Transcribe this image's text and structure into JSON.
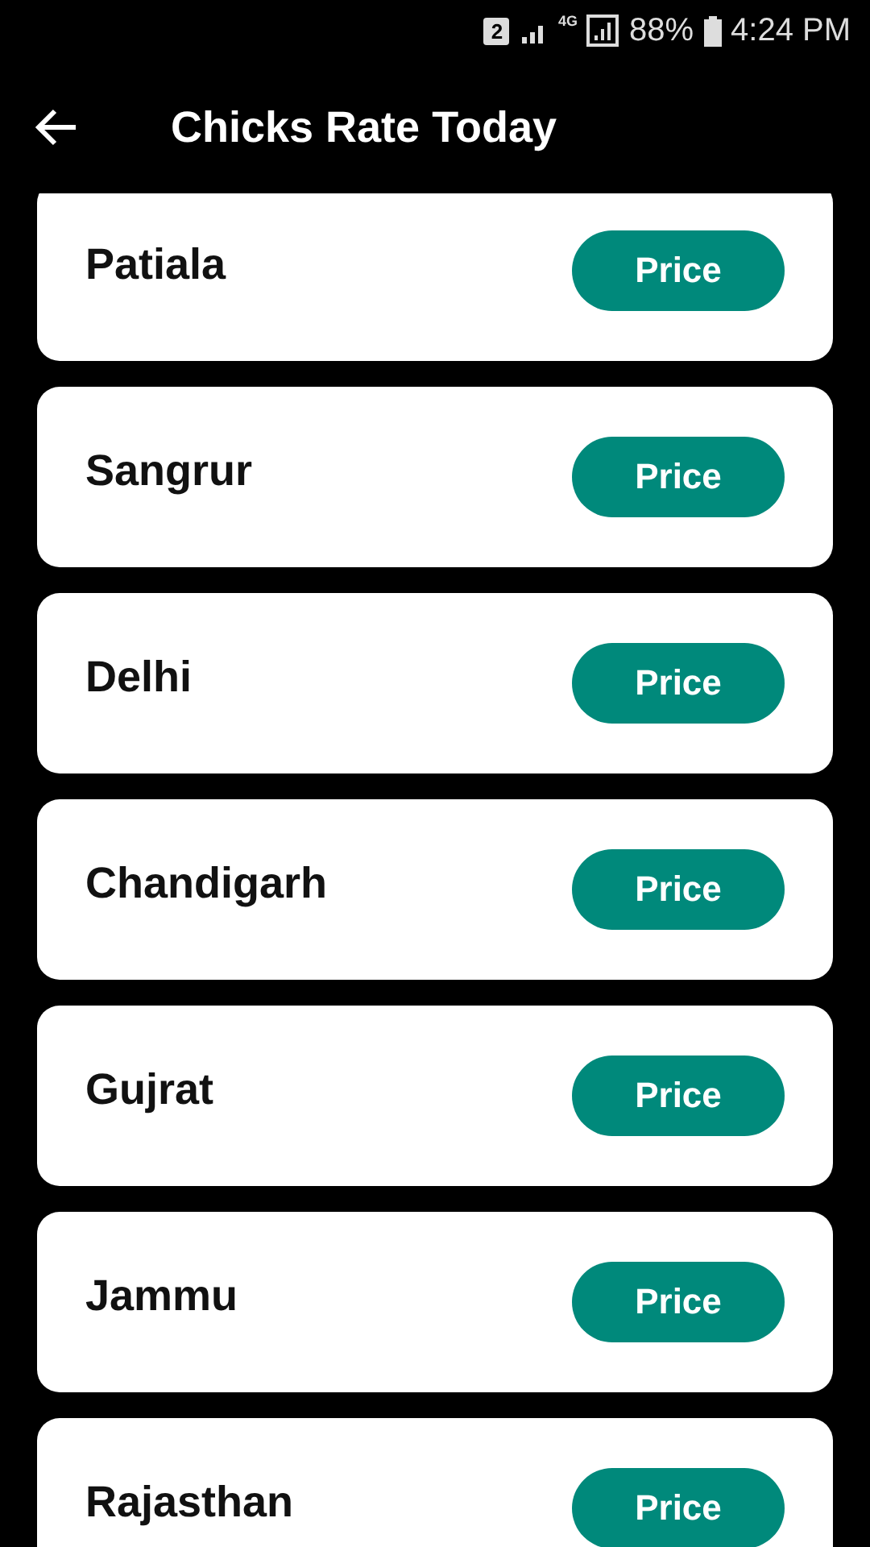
{
  "status_bar": {
    "sim": "2",
    "network": "4G",
    "battery": "88%",
    "time": "4:24 PM"
  },
  "app_bar": {
    "title": "Chicks Rate Today"
  },
  "cities": [
    {
      "name": "Patiala",
      "button": "Price"
    },
    {
      "name": "Sangrur",
      "button": "Price"
    },
    {
      "name": "Delhi",
      "button": "Price"
    },
    {
      "name": "Chandigarh",
      "button": "Price"
    },
    {
      "name": "Gujrat",
      "button": "Price"
    },
    {
      "name": "Jammu",
      "button": "Price"
    },
    {
      "name": "Rajasthan",
      "button": "Price"
    }
  ]
}
